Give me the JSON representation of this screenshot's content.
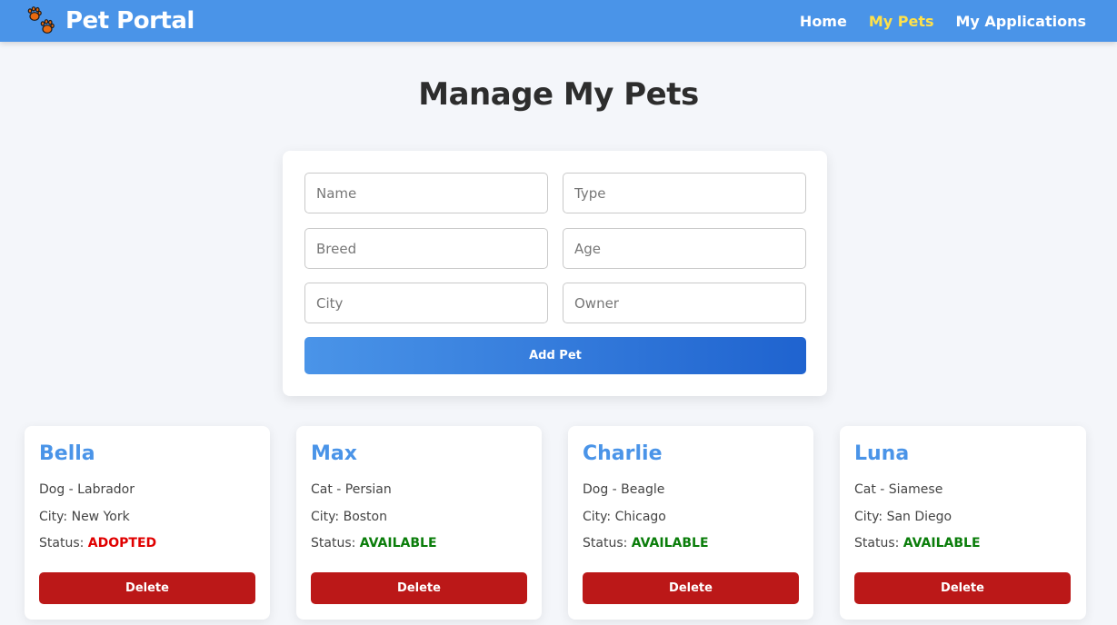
{
  "nav": {
    "brand_icon": "paw-icon",
    "brand_title": "Pet Portal",
    "links": [
      {
        "label": "Home",
        "active": false
      },
      {
        "label": "My Pets",
        "active": true
      },
      {
        "label": "My Applications",
        "active": false
      }
    ],
    "color": "#4a94e8",
    "active_link_color": "#ffe14a"
  },
  "page": {
    "title": "Manage My Pets"
  },
  "form": {
    "fields": [
      {
        "placeholder": "Name",
        "value": ""
      },
      {
        "placeholder": "Type",
        "value": ""
      },
      {
        "placeholder": "Breed",
        "value": ""
      },
      {
        "placeholder": "Age",
        "value": ""
      },
      {
        "placeholder": "City",
        "value": ""
      },
      {
        "placeholder": "Owner",
        "value": ""
      }
    ],
    "submit_label": "Add Pet"
  },
  "pets": [
    {
      "name": "Bella",
      "type_breed": "Dog - Labrador",
      "city_label": "City:",
      "city": "New York",
      "status_label": "Status:",
      "status": "ADOPTED",
      "status_color": "#e00000",
      "delete_label": "Delete"
    },
    {
      "name": "Max",
      "type_breed": "Cat - Persian",
      "city_label": "City:",
      "city": "Boston",
      "status_label": "Status:",
      "status": "AVAILABLE",
      "status_color": "#0a7d0a",
      "delete_label": "Delete"
    },
    {
      "name": "Charlie",
      "type_breed": "Dog - Beagle",
      "city_label": "City:",
      "city": "Chicago",
      "status_label": "Status:",
      "status": "AVAILABLE",
      "status_color": "#0a7d0a",
      "delete_label": "Delete"
    },
    {
      "name": "Luna",
      "type_breed": "Cat - Siamese",
      "city_label": "City:",
      "city": "San Diego",
      "status_label": "Status:",
      "status": "AVAILABLE",
      "status_color": "#0a7d0a",
      "delete_label": "Delete"
    }
  ]
}
